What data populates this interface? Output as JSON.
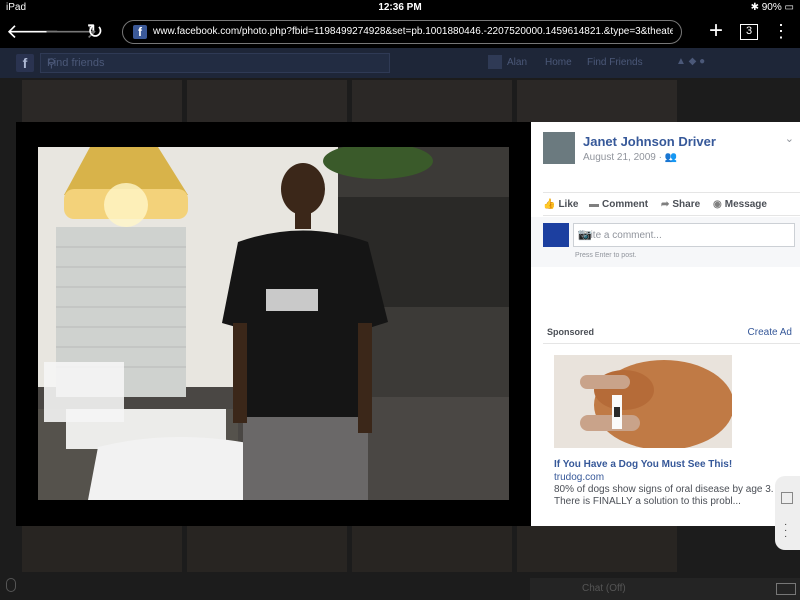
{
  "status_bar": {
    "device": "iPad",
    "time": "12:36 PM",
    "battery": "90%"
  },
  "browser": {
    "url": "www.facebook.com/photo.php?fbid=1198499274928&set=pb.1001880446.-2207520000.1459614821.&type=3&theater",
    "tab_count": "3"
  },
  "fb_header": {
    "search_placeholder": "Find friends",
    "user": "Alan",
    "home": "Home",
    "find_friends": "Find Friends"
  },
  "photo_panel": {
    "owner": "Janet Johnson Driver",
    "date": "August 21, 2009 · ",
    "actions": {
      "like": "Like",
      "comment": "Comment",
      "share": "Share",
      "message": "Message"
    },
    "comment_placeholder": "Write a comment...",
    "comment_hint": "Press Enter to post."
  },
  "ad": {
    "section_label": "Sponsored",
    "create_ad": "Create Ad",
    "title": "If You Have a Dog You Must See This!",
    "domain": "trudog.com",
    "text": "80% of dogs show signs of oral disease by age 3. There is FINALLY a solution to this probl..."
  },
  "chat": {
    "label": "Chat (Off)"
  }
}
